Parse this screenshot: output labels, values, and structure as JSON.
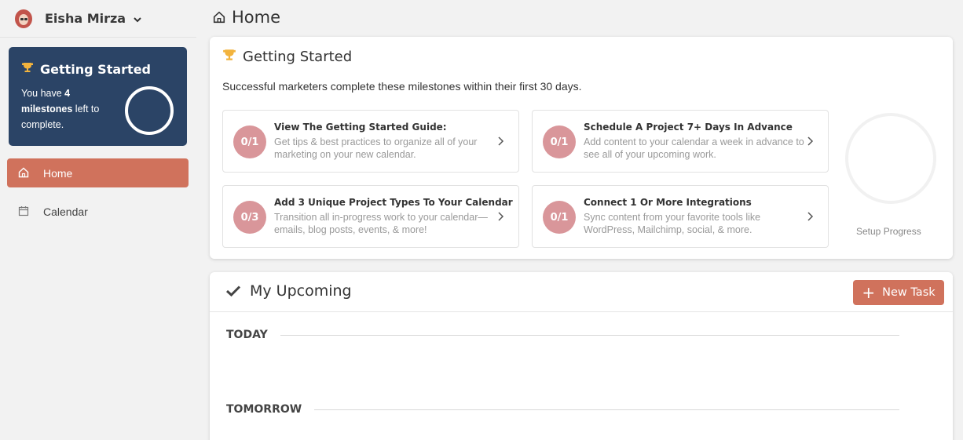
{
  "user": {
    "name": "Eisha Mirza"
  },
  "sidebar": {
    "getting_started": {
      "title": "Getting Started",
      "text_before": "You have ",
      "count": "4",
      "bold_word": "milestones",
      "text_after": " left to complete."
    },
    "nav": [
      {
        "label": "Home",
        "icon": "home-icon",
        "active": true
      },
      {
        "label": "Calendar",
        "icon": "calendar-icon",
        "active": false
      }
    ]
  },
  "page": {
    "title": "Home"
  },
  "getting_started": {
    "title": "Getting Started",
    "subtitle": "Successful marketers complete these milestones within their first 30 days.",
    "milestones": [
      {
        "count": "0/1",
        "title": "View The Getting Started Guide:",
        "desc": "Get tips & best practices to organize all of your marketing on your new calendar."
      },
      {
        "count": "0/1",
        "title": "Schedule A Project 7+ Days In Advance",
        "desc": "Add content to your calendar a week in advance to see all of your upcoming work."
      },
      {
        "count": "0/3",
        "title": "Add 3 Unique Project Types To Your Calendar",
        "desc": "Transition all in-progress work to your calendar—emails, blog posts, events, & more!"
      },
      {
        "count": "0/1",
        "title": "Connect 1 Or More Integrations",
        "desc": "Sync content from your favorite tools like WordPress, Mailchimp, social, & more."
      }
    ],
    "setup_progress_label": "Setup Progress"
  },
  "upcoming": {
    "title": "My Upcoming",
    "new_task_label": "New Task",
    "days": [
      "TODAY",
      "TOMORROW"
    ]
  },
  "colors": {
    "accent": "#d0725c",
    "sidebar_card": "#2b4466",
    "milestone_badge": "#d9969a",
    "trophy": "#f2b33d"
  }
}
